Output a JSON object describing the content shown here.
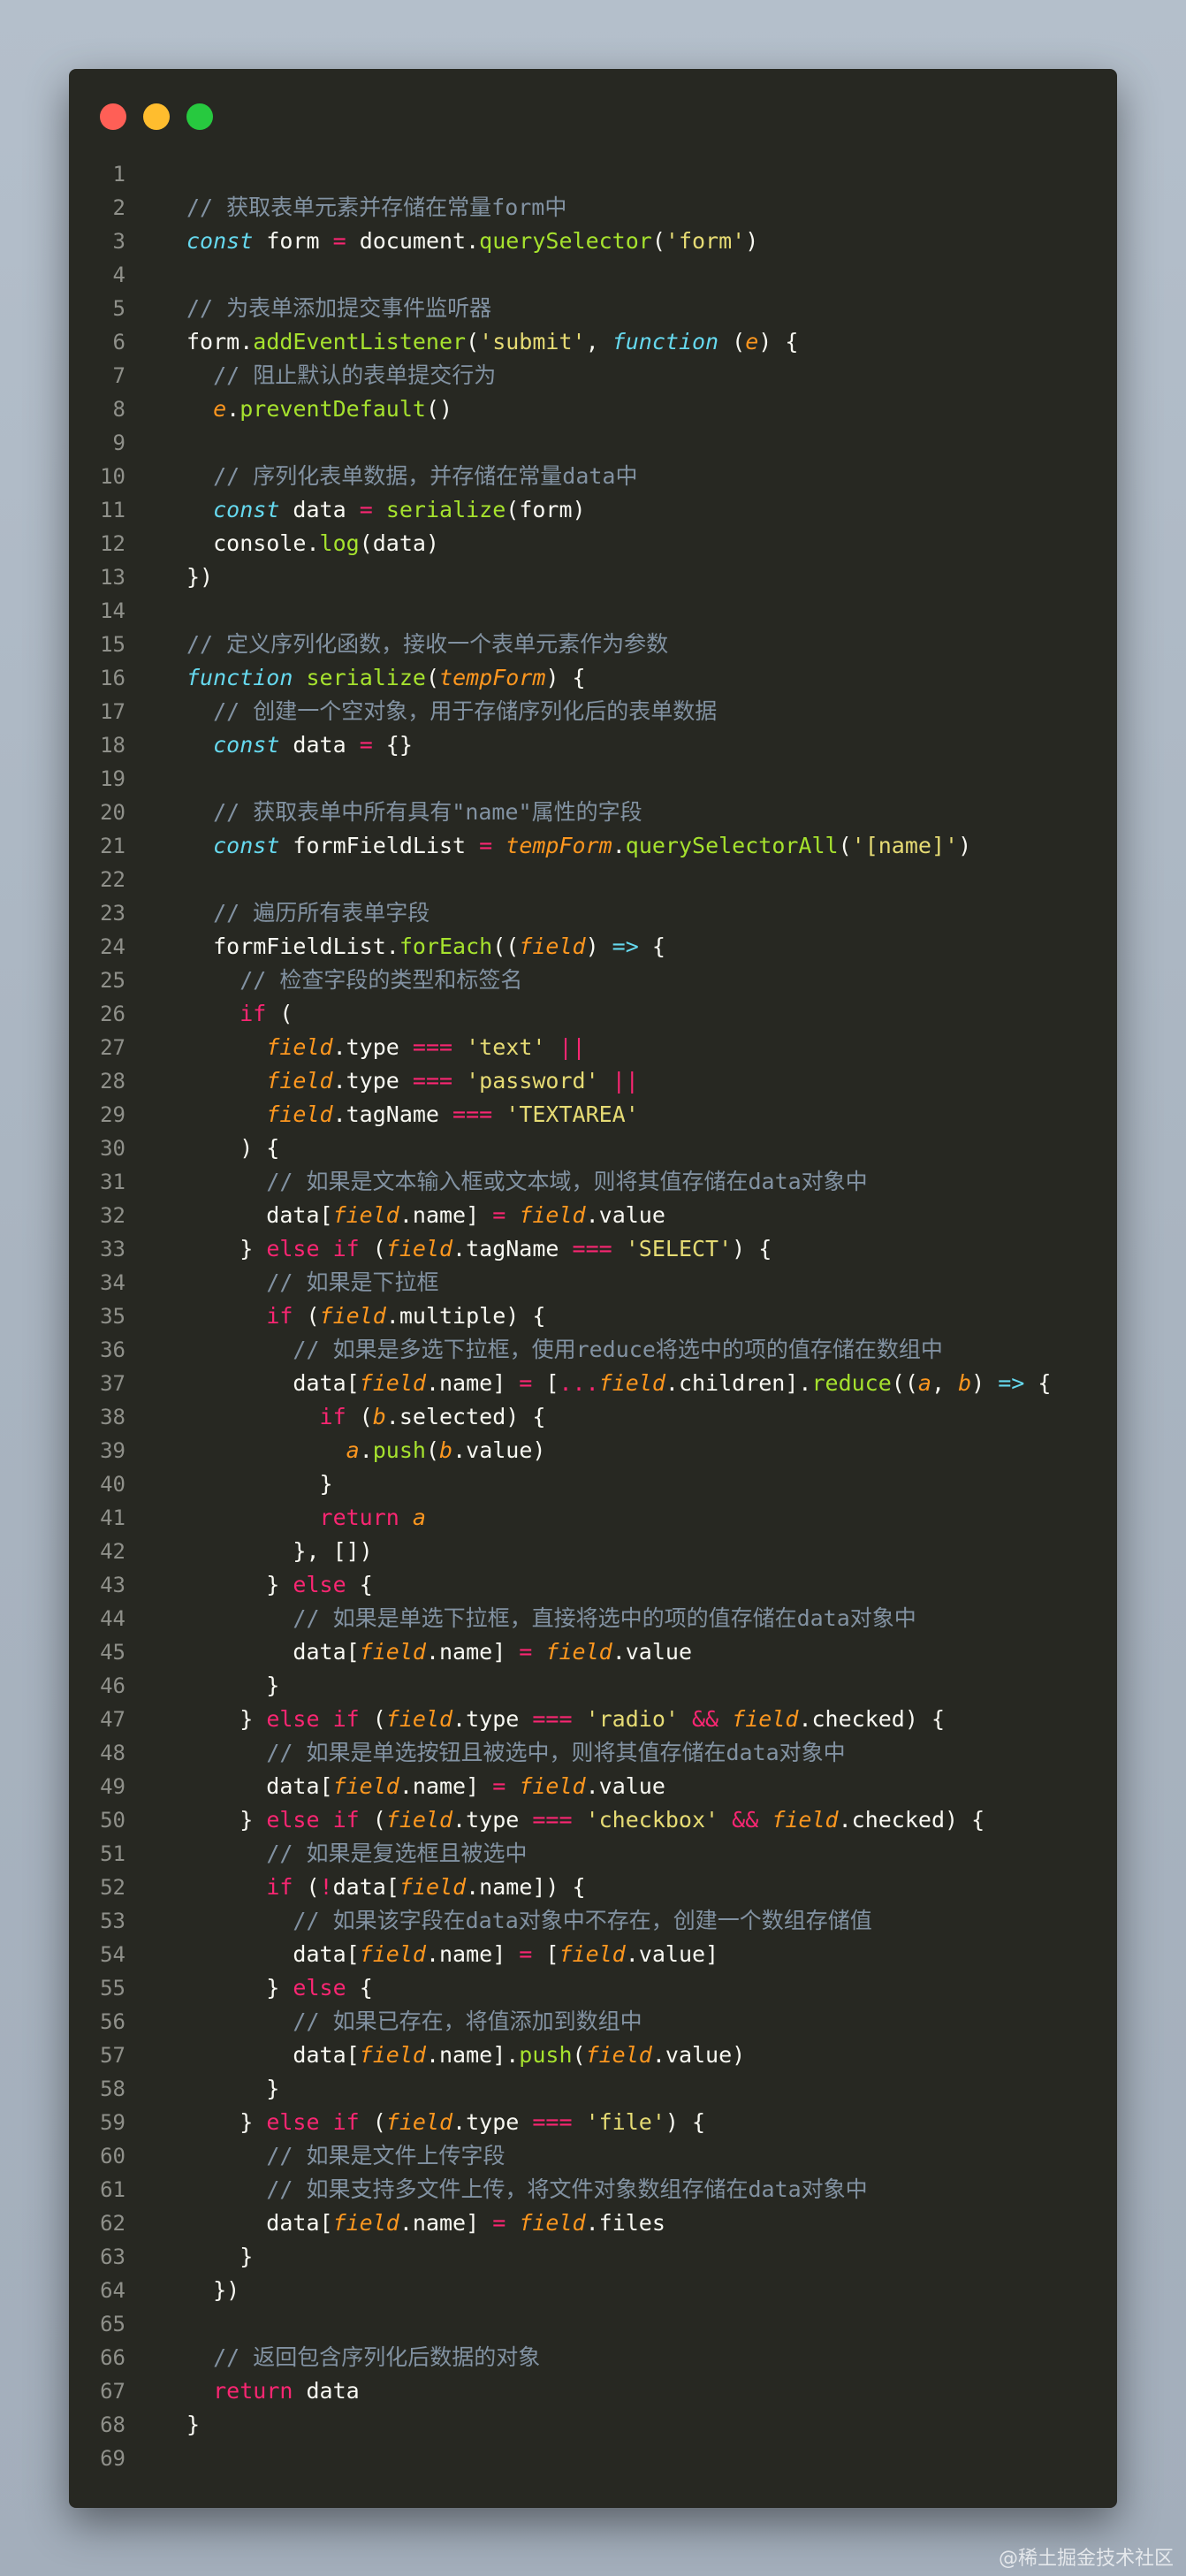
{
  "window": {
    "title_dots": [
      "close",
      "minimize",
      "maximize"
    ],
    "colors": {
      "background": "#272822",
      "close": "#ff5f56",
      "minimize": "#ffbd2e",
      "maximize": "#27c93f"
    }
  },
  "syntax_colors": {
    "comment": "#8292a2",
    "keyword": "#66d9ef",
    "control": "#f92672",
    "string": "#e6db74",
    "function": "#a6e22e",
    "parameter": "#fd971f",
    "plain": "#f8f8f2"
  },
  "code": {
    "language": "javascript",
    "lines": [
      [],
      [
        [
          "c",
          "// 获取表单元素并存储在常量form中"
        ]
      ],
      [
        [
          "k",
          "const"
        ],
        [
          "p",
          " form "
        ],
        [
          "o",
          "="
        ],
        [
          "p",
          " document."
        ],
        [
          "f",
          "querySelector"
        ],
        [
          "p",
          "("
        ],
        [
          "s",
          "'form'"
        ],
        [
          "p",
          ")"
        ]
      ],
      [],
      [
        [
          "c",
          "// 为表单添加提交事件监听器"
        ]
      ],
      [
        [
          "p",
          "form."
        ],
        [
          "f",
          "addEventListener"
        ],
        [
          "p",
          "("
        ],
        [
          "s",
          "'submit'"
        ],
        [
          "p",
          ", "
        ],
        [
          "k",
          "function"
        ],
        [
          "p",
          " ("
        ],
        [
          "v",
          "e"
        ],
        [
          "p",
          ") {"
        ]
      ],
      [
        [
          "p",
          "  "
        ],
        [
          "c",
          "// 阻止默认的表单提交行为"
        ]
      ],
      [
        [
          "p",
          "  "
        ],
        [
          "v",
          "e"
        ],
        [
          "p",
          "."
        ],
        [
          "f",
          "preventDefault"
        ],
        [
          "p",
          "()"
        ]
      ],
      [],
      [
        [
          "p",
          "  "
        ],
        [
          "c",
          "// 序列化表单数据，并存储在常量data中"
        ]
      ],
      [
        [
          "p",
          "  "
        ],
        [
          "k",
          "const"
        ],
        [
          "p",
          " data "
        ],
        [
          "o",
          "="
        ],
        [
          "p",
          " "
        ],
        [
          "f",
          "serialize"
        ],
        [
          "p",
          "(form)"
        ]
      ],
      [
        [
          "p",
          "  console."
        ],
        [
          "f",
          "log"
        ],
        [
          "p",
          "(data)"
        ]
      ],
      [
        [
          "p",
          "})"
        ]
      ],
      [],
      [
        [
          "c",
          "// 定义序列化函数，接收一个表单元素作为参数"
        ]
      ],
      [
        [
          "k",
          "function"
        ],
        [
          "p",
          " "
        ],
        [
          "f",
          "serialize"
        ],
        [
          "p",
          "("
        ],
        [
          "v",
          "tempForm"
        ],
        [
          "p",
          ") {"
        ]
      ],
      [
        [
          "p",
          "  "
        ],
        [
          "c",
          "// 创建一个空对象，用于存储序列化后的表单数据"
        ]
      ],
      [
        [
          "p",
          "  "
        ],
        [
          "k",
          "const"
        ],
        [
          "p",
          " data "
        ],
        [
          "o",
          "="
        ],
        [
          "p",
          " {}"
        ]
      ],
      [],
      [
        [
          "p",
          "  "
        ],
        [
          "c",
          "// 获取表单中所有具有\"name\"属性的字段"
        ]
      ],
      [
        [
          "p",
          "  "
        ],
        [
          "k",
          "const"
        ],
        [
          "p",
          " formFieldList "
        ],
        [
          "o",
          "="
        ],
        [
          "p",
          " "
        ],
        [
          "v",
          "tempForm"
        ],
        [
          "p",
          "."
        ],
        [
          "f",
          "querySelectorAll"
        ],
        [
          "p",
          "("
        ],
        [
          "s",
          "'[name]'"
        ],
        [
          "p",
          ")"
        ]
      ],
      [],
      [
        [
          "p",
          "  "
        ],
        [
          "c",
          "// 遍历所有表单字段"
        ]
      ],
      [
        [
          "p",
          "  formFieldList."
        ],
        [
          "f",
          "forEach"
        ],
        [
          "p",
          "(("
        ],
        [
          "v",
          "field"
        ],
        [
          "p",
          ") "
        ],
        [
          "k",
          "=>"
        ],
        [
          "p",
          " {"
        ]
      ],
      [
        [
          "p",
          "    "
        ],
        [
          "c",
          "// 检查字段的类型和标签名"
        ]
      ],
      [
        [
          "p",
          "    "
        ],
        [
          "o",
          "if"
        ],
        [
          "p",
          " ("
        ]
      ],
      [
        [
          "p",
          "      "
        ],
        [
          "v",
          "field"
        ],
        [
          "p",
          ".type "
        ],
        [
          "o",
          "==="
        ],
        [
          "p",
          " "
        ],
        [
          "s",
          "'text'"
        ],
        [
          "p",
          " "
        ],
        [
          "o",
          "||"
        ]
      ],
      [
        [
          "p",
          "      "
        ],
        [
          "v",
          "field"
        ],
        [
          "p",
          ".type "
        ],
        [
          "o",
          "==="
        ],
        [
          "p",
          " "
        ],
        [
          "s",
          "'password'"
        ],
        [
          "p",
          " "
        ],
        [
          "o",
          "||"
        ]
      ],
      [
        [
          "p",
          "      "
        ],
        [
          "v",
          "field"
        ],
        [
          "p",
          ".tagName "
        ],
        [
          "o",
          "==="
        ],
        [
          "p",
          " "
        ],
        [
          "s",
          "'TEXTAREA'"
        ]
      ],
      [
        [
          "p",
          "    ) {"
        ]
      ],
      [
        [
          "p",
          "      "
        ],
        [
          "c",
          "// 如果是文本输入框或文本域，则将其值存储在data对象中"
        ]
      ],
      [
        [
          "p",
          "      data["
        ],
        [
          "v",
          "field"
        ],
        [
          "p",
          ".name] "
        ],
        [
          "o",
          "="
        ],
        [
          "p",
          " "
        ],
        [
          "v",
          "field"
        ],
        [
          "p",
          ".value"
        ]
      ],
      [
        [
          "p",
          "    } "
        ],
        [
          "o",
          "else if"
        ],
        [
          "p",
          " ("
        ],
        [
          "v",
          "field"
        ],
        [
          "p",
          ".tagName "
        ],
        [
          "o",
          "==="
        ],
        [
          "p",
          " "
        ],
        [
          "s",
          "'SELECT'"
        ],
        [
          "p",
          ") {"
        ]
      ],
      [
        [
          "p",
          "      "
        ],
        [
          "c",
          "// 如果是下拉框"
        ]
      ],
      [
        [
          "p",
          "      "
        ],
        [
          "o",
          "if"
        ],
        [
          "p",
          " ("
        ],
        [
          "v",
          "field"
        ],
        [
          "p",
          ".multiple) {"
        ]
      ],
      [
        [
          "p",
          "        "
        ],
        [
          "c",
          "// 如果是多选下拉框，使用reduce将选中的项的值存储在数组中"
        ]
      ],
      [
        [
          "p",
          "        data["
        ],
        [
          "v",
          "field"
        ],
        [
          "p",
          ".name] "
        ],
        [
          "o",
          "="
        ],
        [
          "p",
          " ["
        ],
        [
          "o",
          "..."
        ],
        [
          "v",
          "field"
        ],
        [
          "p",
          ".children]."
        ],
        [
          "f",
          "reduce"
        ],
        [
          "p",
          "(("
        ],
        [
          "v",
          "a"
        ],
        [
          "p",
          ", "
        ],
        [
          "v",
          "b"
        ],
        [
          "p",
          ") "
        ],
        [
          "k",
          "=>"
        ],
        [
          "p",
          " {"
        ]
      ],
      [
        [
          "p",
          "          "
        ],
        [
          "o",
          "if"
        ],
        [
          "p",
          " ("
        ],
        [
          "v",
          "b"
        ],
        [
          "p",
          ".selected) {"
        ]
      ],
      [
        [
          "p",
          "            "
        ],
        [
          "v",
          "a"
        ],
        [
          "p",
          "."
        ],
        [
          "f",
          "push"
        ],
        [
          "p",
          "("
        ],
        [
          "v",
          "b"
        ],
        [
          "p",
          ".value)"
        ]
      ],
      [
        [
          "p",
          "          }"
        ]
      ],
      [
        [
          "p",
          "          "
        ],
        [
          "o",
          "return"
        ],
        [
          "p",
          " "
        ],
        [
          "v",
          "a"
        ]
      ],
      [
        [
          "p",
          "        }, [])"
        ]
      ],
      [
        [
          "p",
          "      } "
        ],
        [
          "o",
          "else"
        ],
        [
          "p",
          " {"
        ]
      ],
      [
        [
          "p",
          "        "
        ],
        [
          "c",
          "// 如果是单选下拉框，直接将选中的项的值存储在data对象中"
        ]
      ],
      [
        [
          "p",
          "        data["
        ],
        [
          "v",
          "field"
        ],
        [
          "p",
          ".name] "
        ],
        [
          "o",
          "="
        ],
        [
          "p",
          " "
        ],
        [
          "v",
          "field"
        ],
        [
          "p",
          ".value"
        ]
      ],
      [
        [
          "p",
          "      }"
        ]
      ],
      [
        [
          "p",
          "    } "
        ],
        [
          "o",
          "else if"
        ],
        [
          "p",
          " ("
        ],
        [
          "v",
          "field"
        ],
        [
          "p",
          ".type "
        ],
        [
          "o",
          "==="
        ],
        [
          "p",
          " "
        ],
        [
          "s",
          "'radio'"
        ],
        [
          "p",
          " "
        ],
        [
          "o",
          "&&"
        ],
        [
          "p",
          " "
        ],
        [
          "v",
          "field"
        ],
        [
          "p",
          ".checked) {"
        ]
      ],
      [
        [
          "p",
          "      "
        ],
        [
          "c",
          "// 如果是单选按钮且被选中，则将其值存储在data对象中"
        ]
      ],
      [
        [
          "p",
          "      data["
        ],
        [
          "v",
          "field"
        ],
        [
          "p",
          ".name] "
        ],
        [
          "o",
          "="
        ],
        [
          "p",
          " "
        ],
        [
          "v",
          "field"
        ],
        [
          "p",
          ".value"
        ]
      ],
      [
        [
          "p",
          "    } "
        ],
        [
          "o",
          "else if"
        ],
        [
          "p",
          " ("
        ],
        [
          "v",
          "field"
        ],
        [
          "p",
          ".type "
        ],
        [
          "o",
          "==="
        ],
        [
          "p",
          " "
        ],
        [
          "s",
          "'checkbox'"
        ],
        [
          "p",
          " "
        ],
        [
          "o",
          "&&"
        ],
        [
          "p",
          " "
        ],
        [
          "v",
          "field"
        ],
        [
          "p",
          ".checked) {"
        ]
      ],
      [
        [
          "p",
          "      "
        ],
        [
          "c",
          "// 如果是复选框且被选中"
        ]
      ],
      [
        [
          "p",
          "      "
        ],
        [
          "o",
          "if"
        ],
        [
          "p",
          " ("
        ],
        [
          "o",
          "!"
        ],
        [
          "p",
          "data["
        ],
        [
          "v",
          "field"
        ],
        [
          "p",
          ".name]) {"
        ]
      ],
      [
        [
          "p",
          "        "
        ],
        [
          "c",
          "// 如果该字段在data对象中不存在，创建一个数组存储值"
        ]
      ],
      [
        [
          "p",
          "        data["
        ],
        [
          "v",
          "field"
        ],
        [
          "p",
          ".name] "
        ],
        [
          "o",
          "="
        ],
        [
          "p",
          " ["
        ],
        [
          "v",
          "field"
        ],
        [
          "p",
          ".value]"
        ]
      ],
      [
        [
          "p",
          "      } "
        ],
        [
          "o",
          "else"
        ],
        [
          "p",
          " {"
        ]
      ],
      [
        [
          "p",
          "        "
        ],
        [
          "c",
          "// 如果已存在，将值添加到数组中"
        ]
      ],
      [
        [
          "p",
          "        data["
        ],
        [
          "v",
          "field"
        ],
        [
          "p",
          ".name]."
        ],
        [
          "f",
          "push"
        ],
        [
          "p",
          "("
        ],
        [
          "v",
          "field"
        ],
        [
          "p",
          ".value)"
        ]
      ],
      [
        [
          "p",
          "      }"
        ]
      ],
      [
        [
          "p",
          "    } "
        ],
        [
          "o",
          "else if"
        ],
        [
          "p",
          " ("
        ],
        [
          "v",
          "field"
        ],
        [
          "p",
          ".type "
        ],
        [
          "o",
          "==="
        ],
        [
          "p",
          " "
        ],
        [
          "s",
          "'file'"
        ],
        [
          "p",
          ") {"
        ]
      ],
      [
        [
          "p",
          "      "
        ],
        [
          "c",
          "// 如果是文件上传字段"
        ]
      ],
      [
        [
          "p",
          "      "
        ],
        [
          "c",
          "// 如果支持多文件上传，将文件对象数组存储在data对象中"
        ]
      ],
      [
        [
          "p",
          "      data["
        ],
        [
          "v",
          "field"
        ],
        [
          "p",
          ".name] "
        ],
        [
          "o",
          "="
        ],
        [
          "p",
          " "
        ],
        [
          "v",
          "field"
        ],
        [
          "p",
          ".files"
        ]
      ],
      [
        [
          "p",
          "    }"
        ]
      ],
      [
        [
          "p",
          "  })"
        ]
      ],
      [],
      [
        [
          "p",
          "  "
        ],
        [
          "c",
          "// 返回包含序列化后数据的对象"
        ]
      ],
      [
        [
          "p",
          "  "
        ],
        [
          "o",
          "return"
        ],
        [
          "p",
          " data"
        ]
      ],
      [
        [
          "p",
          "}"
        ]
      ],
      []
    ]
  },
  "watermark": "@稀土掘金技术社区"
}
